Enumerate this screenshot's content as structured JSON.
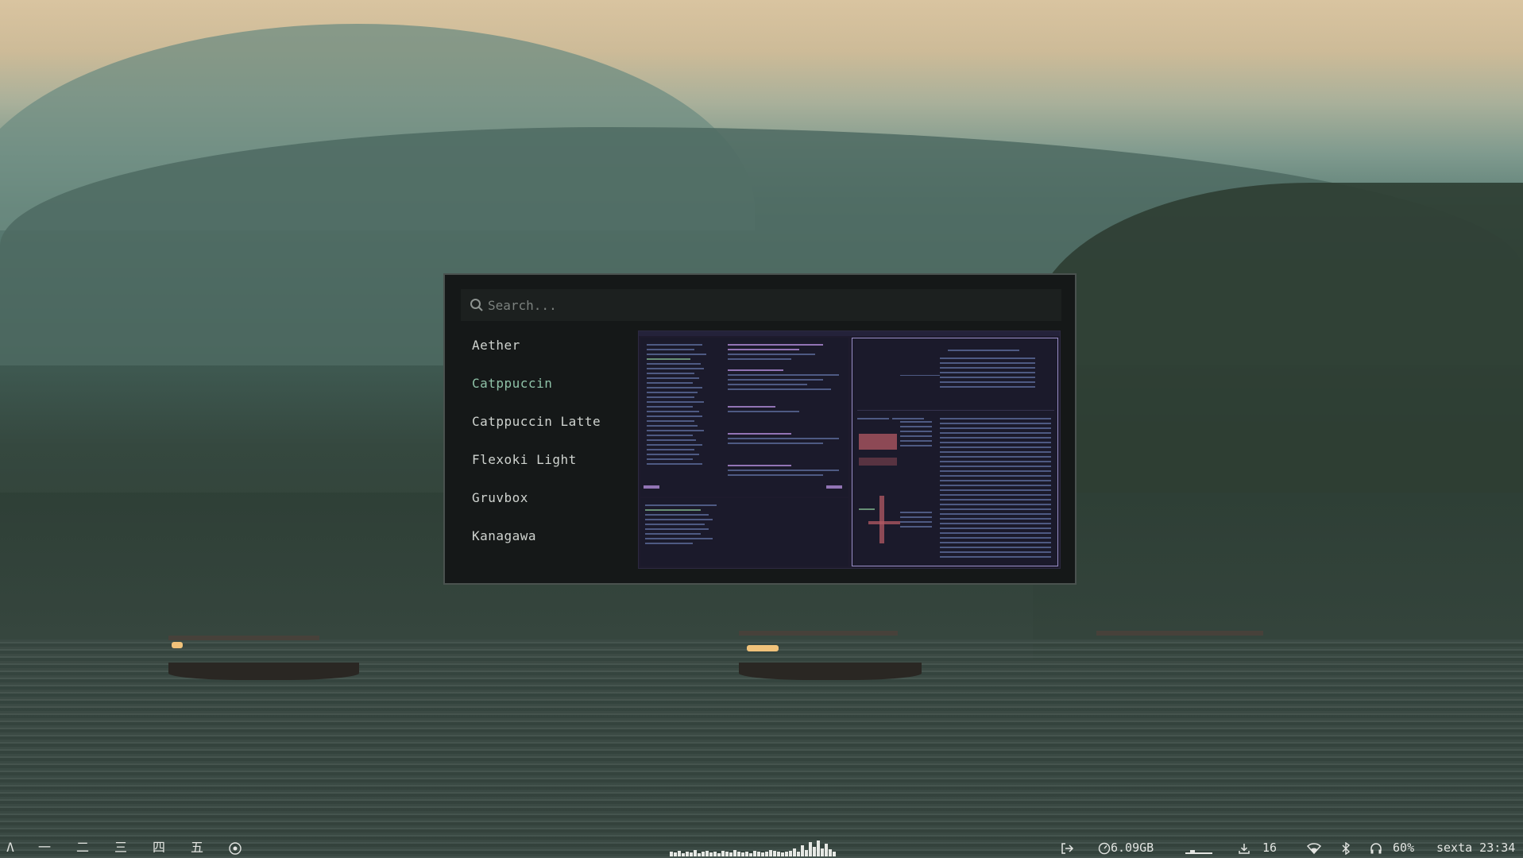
{
  "launcher": {
    "search_placeholder": "Search...",
    "items": [
      {
        "label": "Aether",
        "selected": false
      },
      {
        "label": "Catppuccin",
        "selected": true
      },
      {
        "label": "Catppuccin Latte",
        "selected": false
      },
      {
        "label": "Flexoki Light",
        "selected": false
      },
      {
        "label": "Gruvbox",
        "selected": false
      },
      {
        "label": "Kanagawa",
        "selected": false
      }
    ],
    "selected_color": "#8fc2a8"
  },
  "taskbar": {
    "launcher_glyph": "Λ",
    "workspaces": [
      "一",
      "二",
      "三",
      "四",
      "五"
    ],
    "workspace_extra_icon": "circle-dot-icon",
    "logout_icon": "logout-icon",
    "memory": "6.09GB",
    "downloads_count": "16",
    "volume": "60%",
    "clock": "sexta 23:34",
    "audio_visualizer_levels": [
      0.3,
      0.25,
      0.35,
      0.2,
      0.3,
      0.25,
      0.4,
      0.2,
      0.3,
      0.35,
      0.25,
      0.3,
      0.2,
      0.35,
      0.3,
      0.25,
      0.4,
      0.3,
      0.25,
      0.3,
      0.2,
      0.35,
      0.3,
      0.25,
      0.3,
      0.4,
      0.35,
      0.3,
      0.25,
      0.3,
      0.35,
      0.5,
      0.3,
      0.7,
      0.4,
      0.9,
      0.6,
      1.0,
      0.5,
      0.8,
      0.45,
      0.3
    ]
  }
}
